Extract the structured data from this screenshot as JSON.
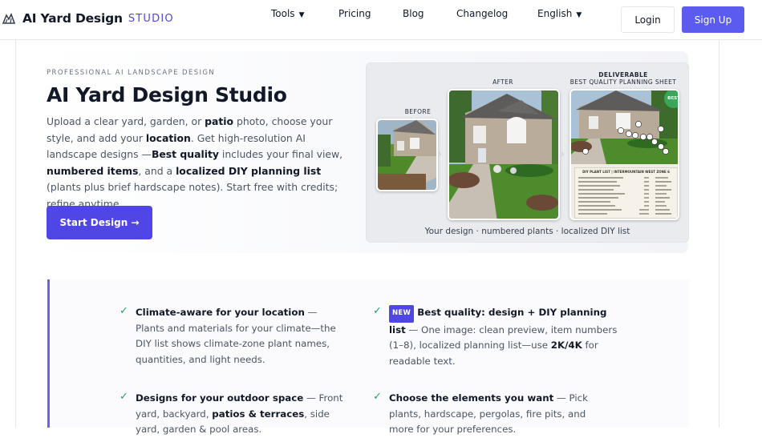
{
  "header": {
    "brand_name": "AI Yard Design",
    "brand_suffix": "STUDIO",
    "nav": [
      {
        "label": "Tools",
        "has_caret": true
      },
      {
        "label": "Pricing"
      },
      {
        "label": "Blog"
      },
      {
        "label": "Changelog"
      },
      {
        "label": "English",
        "has_caret": true
      }
    ],
    "caret": "▼",
    "login_label": "Login",
    "signup_label": "Sign Up"
  },
  "hero": {
    "eyebrow": "PROFESSIONAL AI LANDSCAPE DESIGN",
    "title": "AI Yard Design Studio",
    "desc_parts": {
      "p1": "Upload a clear yard, garden, or ",
      "b1": "patio",
      "p2": " photo, choose your style, and add your ",
      "b2": "location",
      "p3": ". Get high-resolution AI landscape designs —",
      "b3": "Best quality",
      "p4": " includes your final view, ",
      "b4": "numbered items",
      "p5": ", and a ",
      "b5": "localized DIY planning list",
      "p6": " (plants plus brief hardscape notes). Start free with credits; refine anytime."
    },
    "cta_label": "Start Design →"
  },
  "preview": {
    "before_label": "BEFORE",
    "after_label": "AFTER",
    "deliverable_label": "DELIVERABLE",
    "deliverable_sub": "BEST QUALITY PLANNING SHEET",
    "best_badge": "BEST",
    "plant_list_title": "DIY PLANT LIST | INTERMOUNTAIN WEST ZONE 6",
    "caption": "Your design · numbered plants · localized DIY list"
  },
  "features": [
    {
      "title": "Climate-aware for your location",
      "text": " — Plants and materials for your climate—the DIY list shows climate-zone plant names, quantities, and light needs."
    },
    {
      "badge": "NEW",
      "title": "Best quality: design + DIY planning list",
      "text": " — One image: clean preview, item numbers (1–8), localized planning list—use ",
      "b": "2K/4K",
      "tail": " for readable text."
    },
    {
      "title": "Designs for your outdoor space",
      "text": " — Front yard, backyard, ",
      "b": "patios & terraces",
      "tail": ", side yard, garden & pool areas."
    },
    {
      "title": "Choose the elements you want",
      "text": " — Pick plants, hardscape, pergolas, fire pits, and more for your preferences."
    }
  ],
  "check_glyph": "✓",
  "colors": {
    "accent": "#4f46e5",
    "signup": "#5b5bf0",
    "check": "#22a35a",
    "feature_border": "#6d5ef0"
  }
}
